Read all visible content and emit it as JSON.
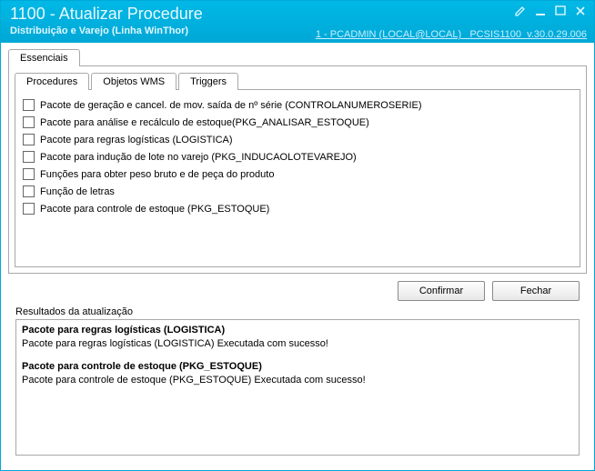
{
  "titlebar": {
    "title": "1100 - Atualizar Procedure",
    "subtitle": "Distribuição e Varejo (Linha WinThor)",
    "right_user": "1 - PCADMIN (LOCAL@LOCAL)",
    "right_app": "PCSIS1100",
    "right_ver": "v.30.0.29.006"
  },
  "tabs": {
    "outer": [
      {
        "label": "Essenciais",
        "active": true
      }
    ],
    "inner": [
      {
        "label": "Procedures",
        "active": true
      },
      {
        "label": "Objetos WMS",
        "active": false
      },
      {
        "label": "Triggers",
        "active": false
      }
    ]
  },
  "checkboxes": [
    "Pacote de geração e cancel. de mov. saída de nº série (CONTROLANUMEROSERIE)",
    "Pacote para análise e recálculo de estoque(PKG_ANALISAR_ESTOQUE)",
    "Pacote para regras logísticas (LOGISTICA)",
    "Pacote para indução de lote no varejo (PKG_INDUCAOLOTEVAREJO)",
    "Funções para obter peso bruto e de peça do produto",
    "Função de letras",
    "Pacote para controle de estoque (PKG_ESTOQUE)"
  ],
  "buttons": {
    "confirm": "Confirmar",
    "close": "Fechar"
  },
  "results": {
    "label": "Resultados da atualização",
    "items": [
      {
        "title": "Pacote para regras logísticas (LOGISTICA)",
        "msg": "Pacote para regras logísticas (LOGISTICA) Executada com sucesso!"
      },
      {
        "title": "Pacote para controle de estoque (PKG_ESTOQUE)",
        "msg": "Pacote para controle de estoque (PKG_ESTOQUE) Executada com sucesso!"
      }
    ]
  }
}
